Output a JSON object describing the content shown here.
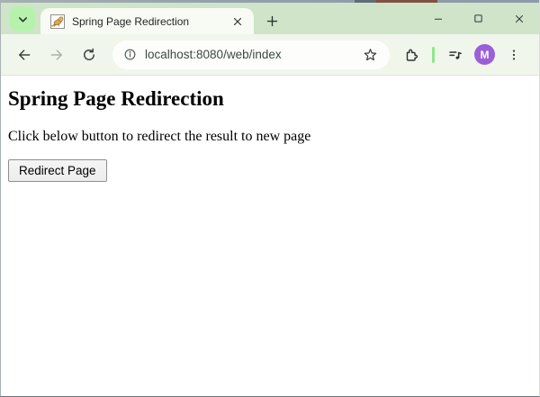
{
  "tab": {
    "title": "Spring Page Redirection",
    "favicon": "tomcat-cat-icon"
  },
  "toolbar": {
    "url": "localhost:8080/web/index"
  },
  "avatar": {
    "initial": "M"
  },
  "page": {
    "heading": "Spring Page Redirection",
    "description": "Click below button to redirect the result to new page",
    "redirect_button_label": "Redirect Page"
  },
  "icons": {
    "tab_strip_left": "chevron-down-icon",
    "tab_right": "close-icon",
    "after_tab": "new-tab-plus-icon",
    "window": [
      "minimize-icon",
      "maximize-icon",
      "close-icon"
    ],
    "navigation": [
      "back-arrow-icon",
      "forward-arrow-icon",
      "reload-icon"
    ],
    "omnibox": [
      "site-info-icon",
      "bookmark-star-icon"
    ],
    "toolbar_right": [
      "extensions-puzzle-icon",
      "media-controls-icon",
      "avatar",
      "kebab-menu-icon"
    ]
  },
  "colors": {
    "tabbar_bg": "#cfe4c9",
    "chevron_bg": "#b7f2ad",
    "tab_bg": "#f8fbf3",
    "toolbar_bg": "#f1f6ed",
    "accent_separator": "#8fe88a",
    "avatar_bg": "#9b5fd9",
    "page_bg": "#ffffff"
  }
}
